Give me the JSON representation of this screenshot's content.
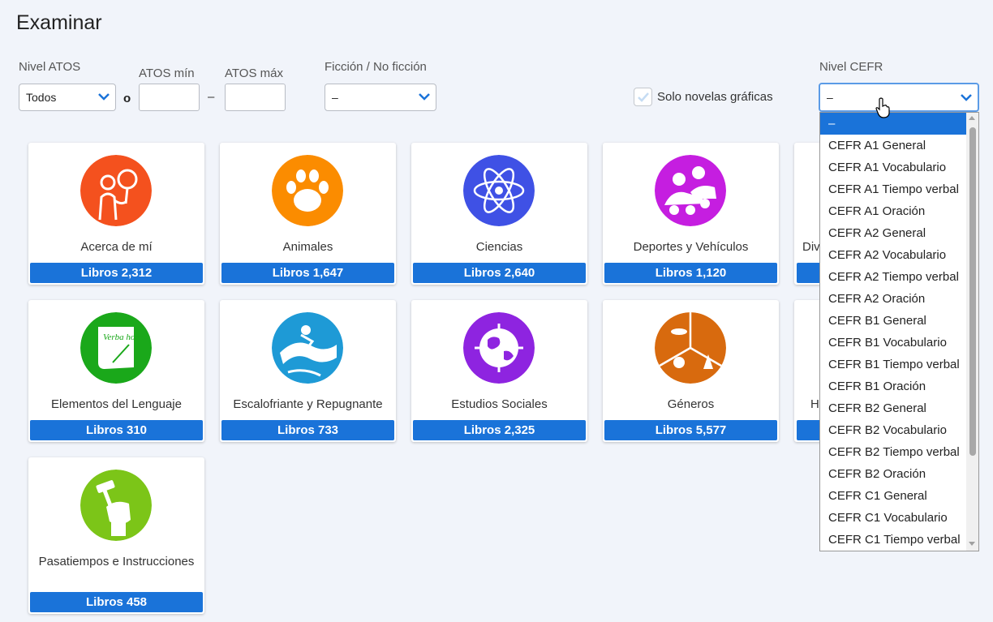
{
  "page": {
    "title": "Examinar"
  },
  "filters": {
    "atos_level": {
      "label": "Nivel ATOS",
      "value": "Todos"
    },
    "or_label": "o",
    "atos_min": {
      "label": "ATOS mín",
      "value": ""
    },
    "dash": "–",
    "atos_max": {
      "label": "ATOS máx",
      "value": ""
    },
    "fiction": {
      "label": "Ficción / No ficción",
      "value": "–"
    },
    "graphic_novels": {
      "label": "Solo novelas gráficas",
      "checked": true
    },
    "cefr": {
      "label": "Nivel CEFR",
      "value": "–"
    }
  },
  "cefr_options": [
    "–",
    "CEFR A1 General",
    "CEFR A1 Vocabulario",
    "CEFR A1 Tiempo verbal",
    "CEFR A1 Oración",
    "CEFR A2 General",
    "CEFR A2 Vocabulario",
    "CEFR A2 Tiempo verbal",
    "CEFR A2 Oración",
    "CEFR B1 General",
    "CEFR B1 Vocabulario",
    "CEFR B1 Tiempo verbal",
    "CEFR B1 Oración",
    "CEFR B2 General",
    "CEFR B2 Vocabulario",
    "CEFR B2 Tiempo verbal",
    "CEFR B2 Oración",
    "CEFR C1 General",
    "CEFR C1 Vocabulario",
    "CEFR C1 Tiempo verbal"
  ],
  "categories": [
    {
      "name": "Acerca de mí",
      "count": "Libros 2,312",
      "icon": "person-magnifier-icon",
      "color": "#f4511e"
    },
    {
      "name": "Animales",
      "count": "Libros 1,647",
      "icon": "paw-icon",
      "color": "#fb8c00"
    },
    {
      "name": "Ciencias",
      "count": "Libros 2,640",
      "icon": "atom-icon",
      "color": "#3f51e5"
    },
    {
      "name": "Deportes y Vehículos",
      "count": "Libros 1,120",
      "icon": "race-car-icon",
      "color": "#c51ee0"
    },
    {
      "name": "Div",
      "count": "",
      "icon": "partial-icon",
      "color": "#ffffff"
    },
    {
      "name": "Elementos del Lenguaje",
      "count": "Libros 310",
      "icon": "scroll-quill-icon",
      "color": "#1aa81a",
      "scroll_text": "Verba hominum"
    },
    {
      "name": "Escalofriante y Repugnante",
      "count": "Libros 733",
      "icon": "slime-slide-icon",
      "color": "#1e9ad6"
    },
    {
      "name": "Estudios Sociales",
      "count": "Libros 2,325",
      "icon": "globe-icon",
      "color": "#8e24e0"
    },
    {
      "name": "Géneros",
      "count": "Libros 5,577",
      "icon": "genres-icon",
      "color": "#d86a0e"
    },
    {
      "name": "H",
      "count": "",
      "icon": "partial-icon",
      "color": "#ffffff"
    },
    {
      "name": "Pasatiempos e Instrucciones",
      "count": "Libros 458",
      "icon": "hammer-fist-icon",
      "color": "#7cc518"
    }
  ]
}
